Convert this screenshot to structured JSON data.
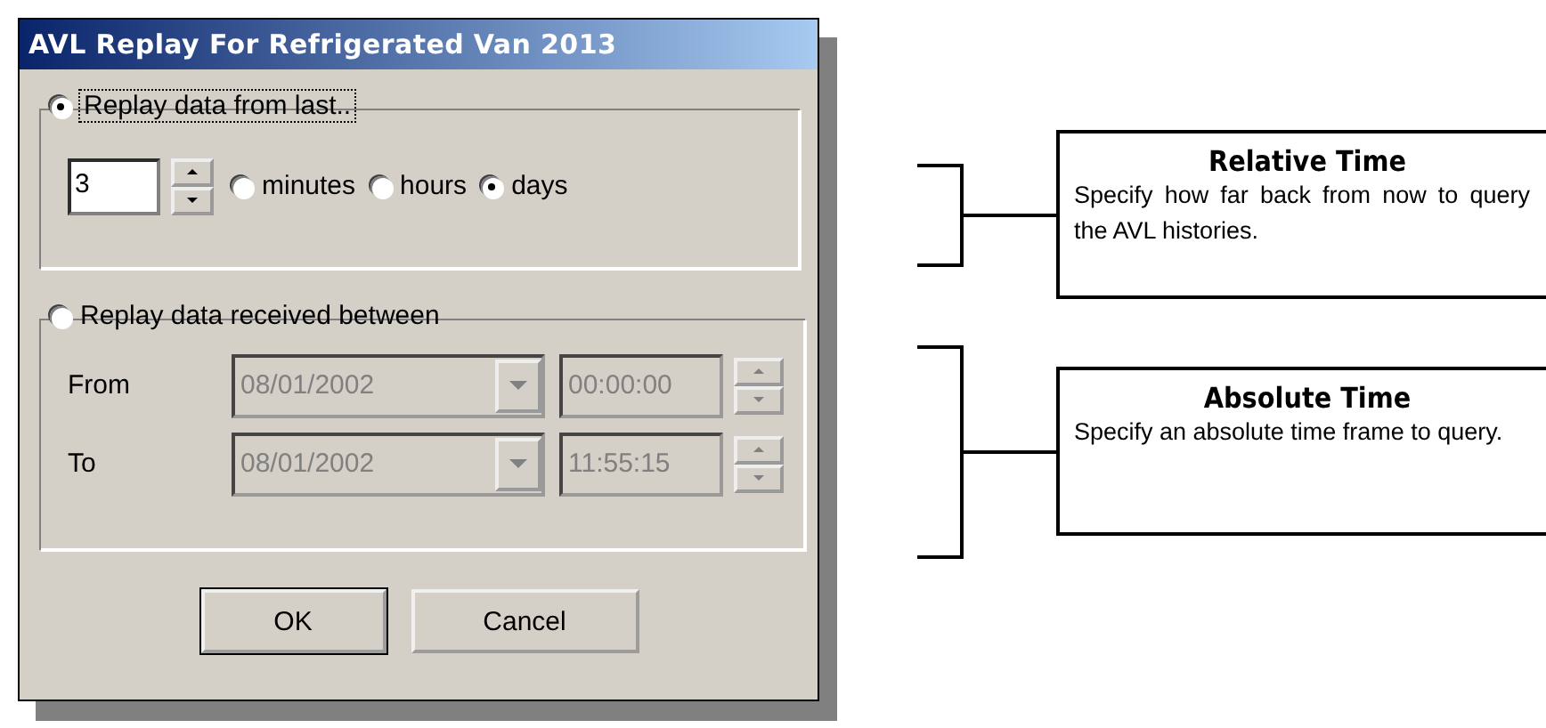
{
  "window": {
    "title": "AVL Replay For Refrigerated Van 2013"
  },
  "relative": {
    "label": "Replay data from last..",
    "selected": true,
    "value": "3",
    "units": [
      {
        "label": "minutes",
        "selected": false
      },
      {
        "label": "hours",
        "selected": false
      },
      {
        "label": "days",
        "selected": true
      }
    ]
  },
  "absolute": {
    "label": "Replay data received between",
    "selected": false,
    "disabled": true,
    "rows": [
      {
        "label": "From",
        "date": "08/01/2002",
        "time": "00:00:00"
      },
      {
        "label": "To",
        "date": "08/01/2002",
        "time": "11:55:15"
      }
    ]
  },
  "buttons": [
    {
      "label": "OK",
      "default": true
    },
    {
      "label": "Cancel",
      "default": false
    }
  ],
  "callouts": [
    {
      "title": "Relative Time",
      "text": "Specify how far back from now to query the AVL histories."
    },
    {
      "title": "Absolute Time",
      "text": "Specify an absolute time frame to query."
    }
  ]
}
